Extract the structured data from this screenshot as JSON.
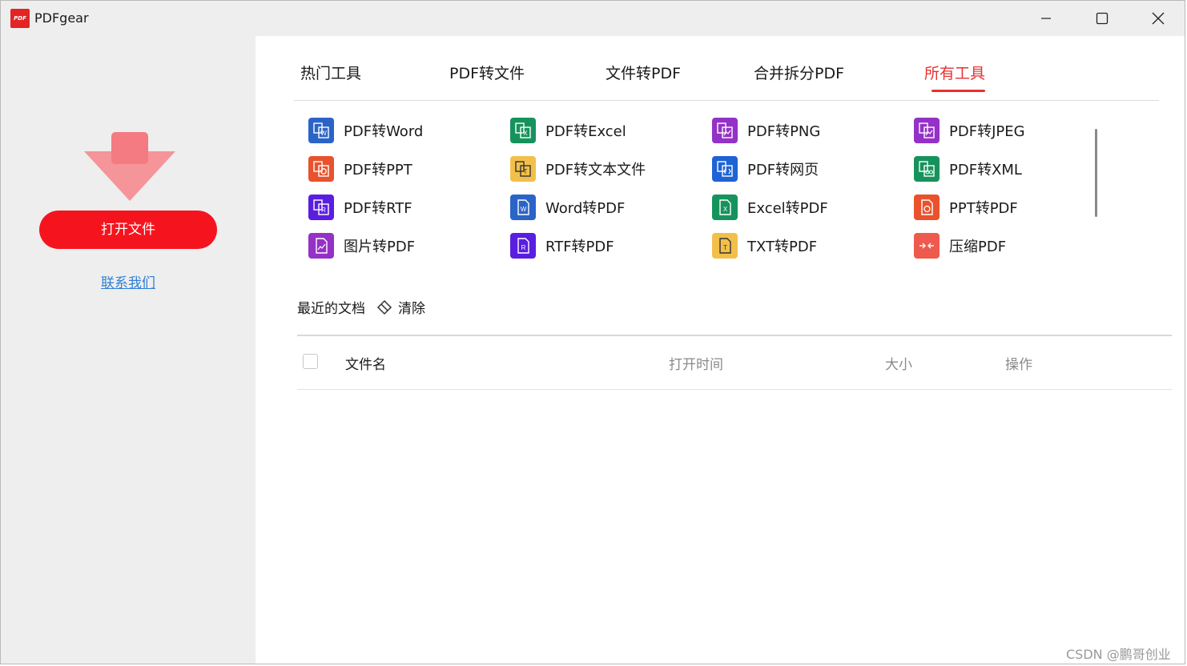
{
  "window": {
    "logo_text": "PDF",
    "title": "PDFgear"
  },
  "sidebar": {
    "open_file": "打开文件",
    "contact": "联系我们"
  },
  "tabs": [
    {
      "label": "热门工具"
    },
    {
      "label": "PDF转文件"
    },
    {
      "label": "文件转PDF"
    },
    {
      "label": "合并拆分PDF"
    },
    {
      "label": "所有工具",
      "active": true
    }
  ],
  "tools": [
    {
      "label": "PDF转Word",
      "color": "#2b64c7",
      "icon": "word-convert-icon"
    },
    {
      "label": "PDF转Excel",
      "color": "#16935c",
      "icon": "excel-convert-icon"
    },
    {
      "label": "PDF转PNG",
      "color": "#9431c7",
      "icon": "image-convert-icon"
    },
    {
      "label": "PDF转JPEG",
      "color": "#9431c7",
      "icon": "image-convert-icon"
    },
    {
      "label": "PDF转PPT",
      "color": "#e9522d",
      "icon": "ppt-convert-icon"
    },
    {
      "label": "PDF转文本文件",
      "color": "#f2c04a",
      "icon": "text-convert-icon"
    },
    {
      "label": "PDF转网页",
      "color": "#1e63d6",
      "icon": "html-convert-icon"
    },
    {
      "label": "PDF转XML",
      "color": "#16935c",
      "icon": "xml-convert-icon"
    },
    {
      "label": "PDF转RTF",
      "color": "#5a1ee0",
      "icon": "rtf-convert-icon"
    },
    {
      "label": "Word转PDF",
      "color": "#2b64c7",
      "icon": "word-to-pdf-icon"
    },
    {
      "label": "Excel转PDF",
      "color": "#16935c",
      "icon": "excel-to-pdf-icon"
    },
    {
      "label": "PPT转PDF",
      "color": "#e9522d",
      "icon": "ppt-to-pdf-icon"
    },
    {
      "label": "图片转PDF",
      "color": "#9431c7",
      "icon": "image-to-pdf-icon"
    },
    {
      "label": "RTF转PDF",
      "color": "#5a1ee0",
      "icon": "rtf-to-pdf-icon"
    },
    {
      "label": "TXT转PDF",
      "color": "#f2c04a",
      "icon": "txt-to-pdf-icon"
    },
    {
      "label": "压缩PDF",
      "color": "#ef5a4e",
      "icon": "compress-icon"
    }
  ],
  "recent": {
    "title": "最近的文档",
    "clear": "清除",
    "columns": {
      "name": "文件名",
      "time": "打开时间",
      "size": "大小",
      "action": "操作"
    }
  },
  "watermark": "CSDN @鹏哥创业"
}
